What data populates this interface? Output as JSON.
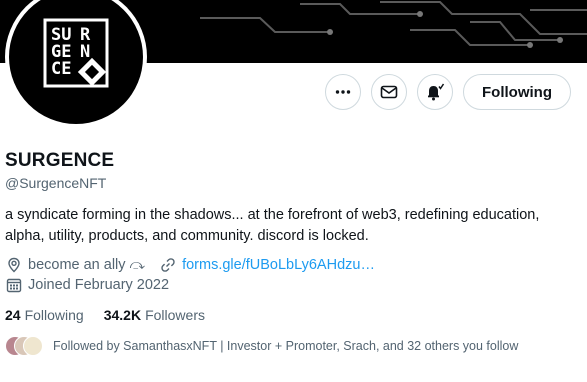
{
  "profile": {
    "name": "SURGENCE",
    "handle": "@SurgenceNFT",
    "bio": "a syndicate forming in the shadows... at the forefront of web3, redefining education, alpha, utility, products, and community. discord is locked.",
    "location": "become an ally ⤼",
    "link": "forms.gle/fUBoLbLy6AHdzu…",
    "joined": "Joined February 2022",
    "avatar_text": "SURGENCE"
  },
  "actions": {
    "more_icon": "more-horizontal-icon",
    "message_icon": "envelope-icon",
    "notify_icon": "bell-check-icon",
    "follow_label": "Following"
  },
  "stats": {
    "following_count": "24",
    "following_label": "Following",
    "followers_count": "34.2K",
    "followers_label": "Followers"
  },
  "followed_by": "Followed by SamanthasxNFT | Investor + Promoter, Srach, and 32 others you follow",
  "colors": {
    "link": "#1d9bf0",
    "secondary_text": "#536471",
    "primary_text": "#0f1419",
    "border": "#cfd9de"
  }
}
